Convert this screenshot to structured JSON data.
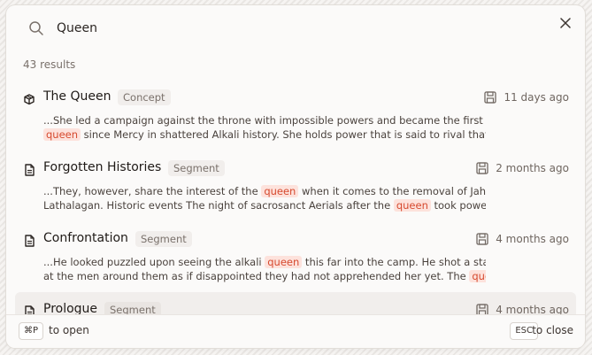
{
  "search": {
    "value": "Queen",
    "placeholder": ""
  },
  "results_count": "43 results",
  "results": [
    {
      "icon": "cube-icon",
      "title": "The Queen",
      "tag": "Concept",
      "meta_icon": "save-icon",
      "time": "11 days ago",
      "line1": [
        "...She led a campaign against the throne with impossible powers and became the first "
      ],
      "line2": [
        "queen",
        " since Mercy in shattered Alkali history. She holds power that is said to rival that of..."
      ]
    },
    {
      "icon": "document-icon",
      "title": "Forgotten Histories",
      "tag": "Segment",
      "meta_icon": "save-icon",
      "time": "2 months ago",
      "line1": [
        "...They, however, share the interest of the ",
        "queen",
        " when it comes to the removal of Jah"
      ],
      "line2": [
        "Lathalagan. Historic events The night of sacrosanct Aerials after the ",
        "queen",
        " took power, i..."
      ]
    },
    {
      "icon": "document-icon",
      "title": "Confrontation",
      "tag": "Segment",
      "meta_icon": "save-icon",
      "time": "4 months ago",
      "line1": [
        "...He looked puzzled upon seeing the alkali ",
        "queen",
        " this far into the camp. He shot a stare"
      ],
      "line2": [
        "at the men around them as if disappointed they had not apprehended her yet. The ",
        "quee..."
      ]
    },
    {
      "icon": "document-icon",
      "title": "Prologue",
      "tag": "Segment",
      "meta_icon": "save-icon",
      "time": "4 months ago",
      "line1": [],
      "line2": []
    }
  ],
  "footer": {
    "open_key": "⌘P",
    "open_label": "to open",
    "close_key": "ESC",
    "close_label": "to close"
  }
}
